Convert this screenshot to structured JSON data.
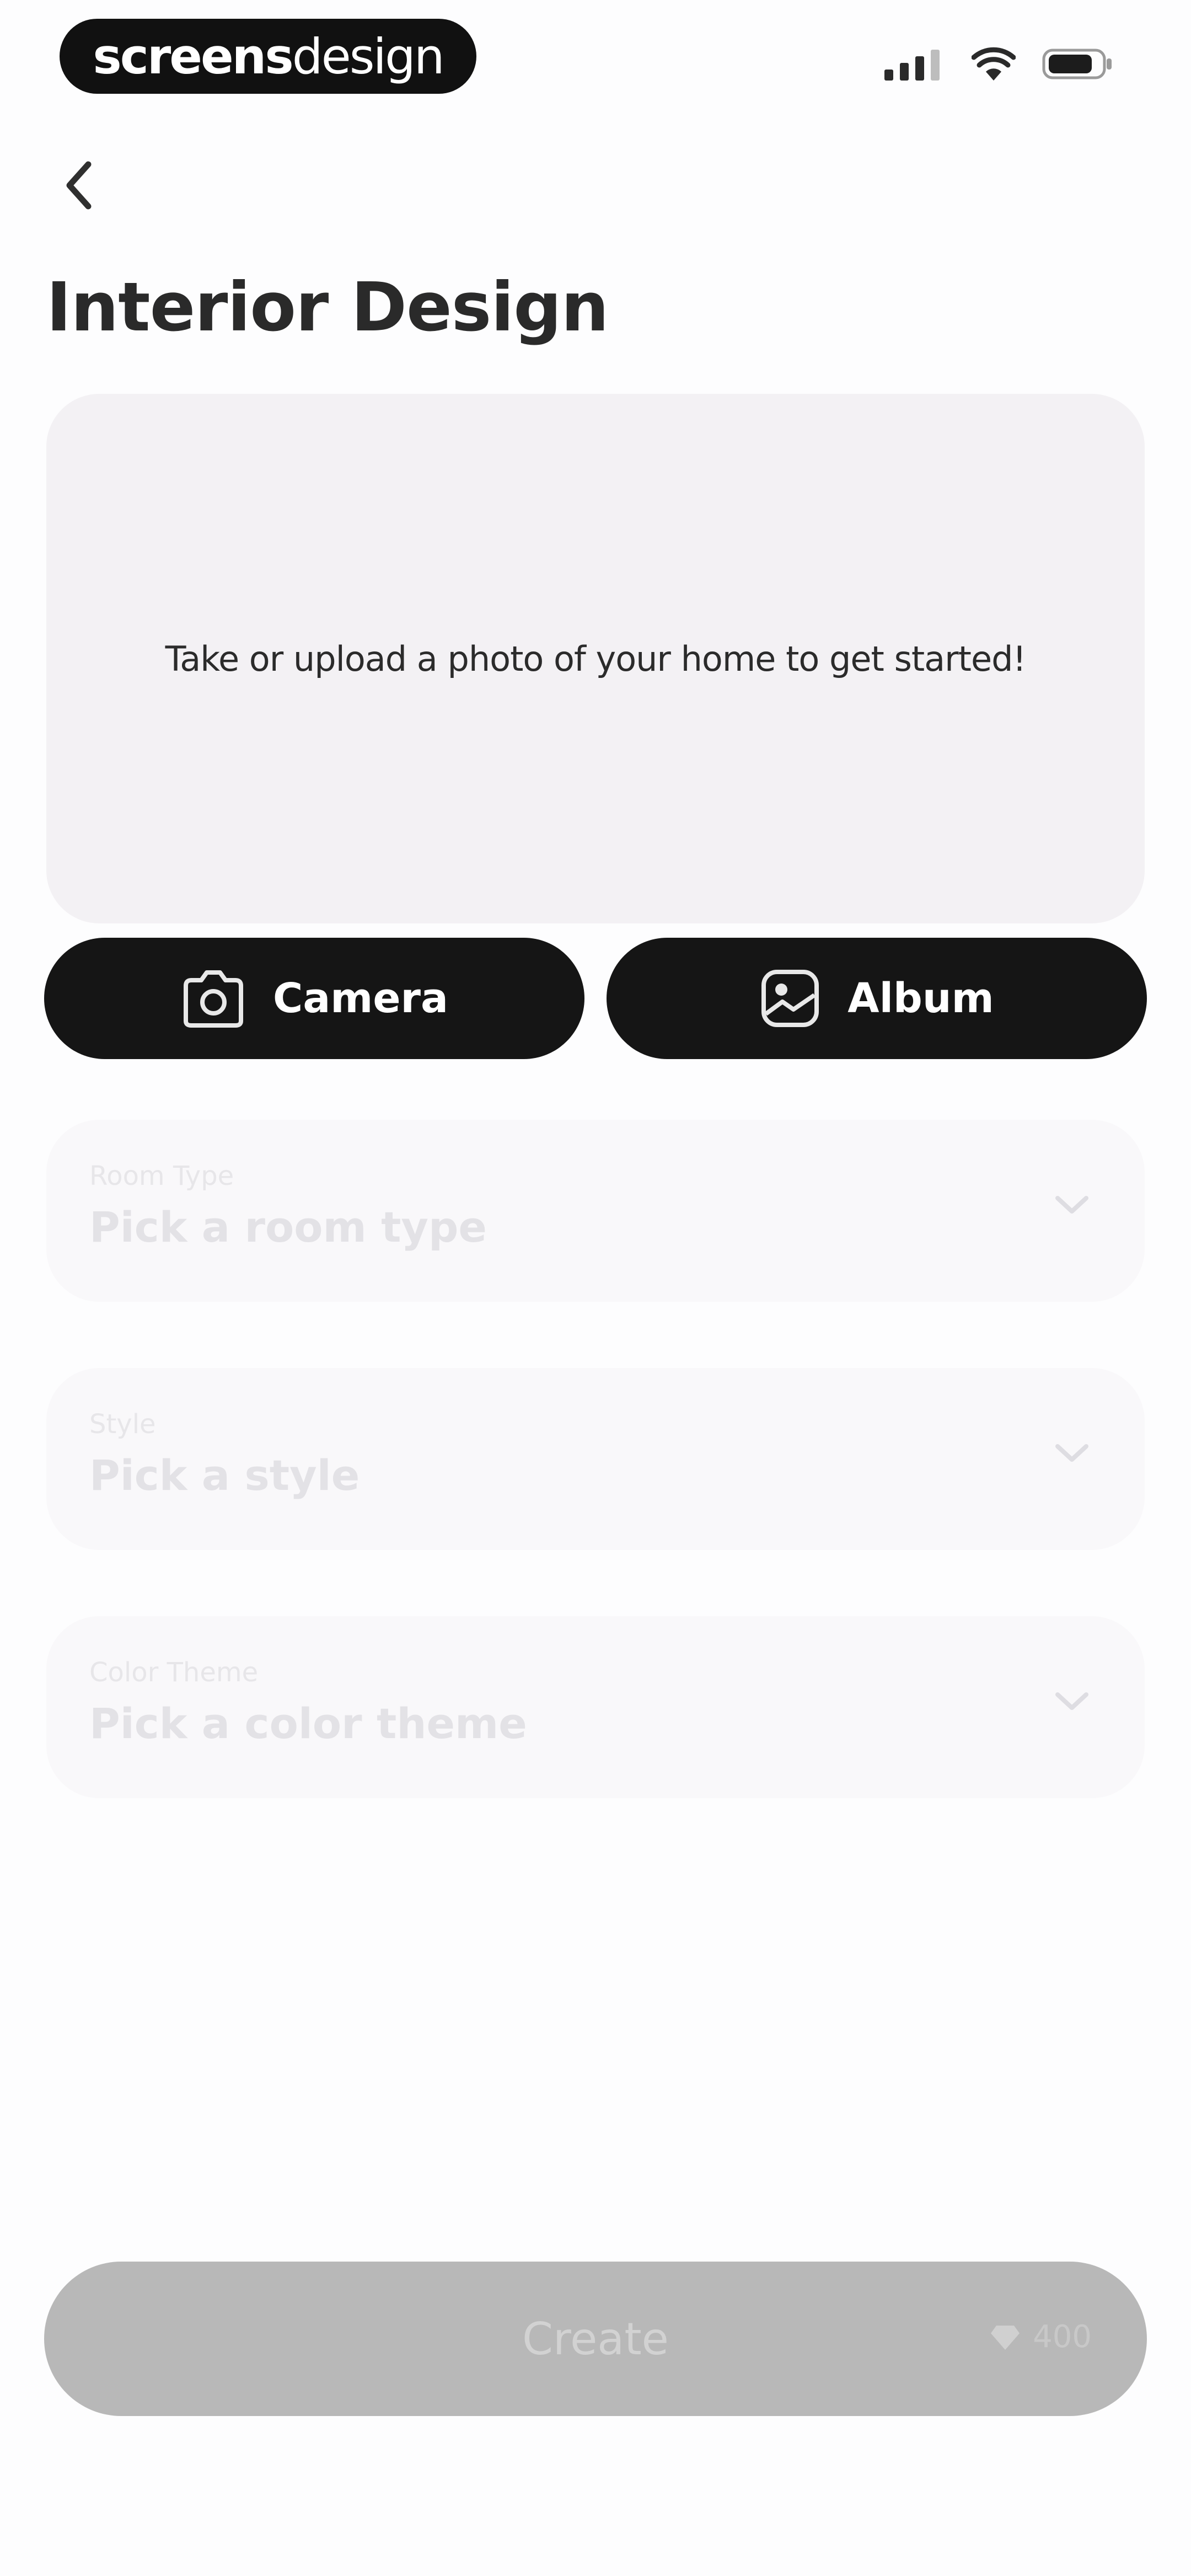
{
  "status_bar": {
    "brand_bold": "screens",
    "brand_light": "design",
    "icons": [
      "signal-icon",
      "wifi-icon",
      "battery-icon"
    ]
  },
  "header": {
    "back_icon": "chevron-left-icon",
    "title": "Interior Design"
  },
  "upload": {
    "prompt": "Take or upload a photo of your home to get started!"
  },
  "actions": {
    "camera_label": "Camera",
    "album_label": "Album"
  },
  "fields": [
    {
      "label": "Room Type",
      "placeholder": "Pick a room type"
    },
    {
      "label": "Style",
      "placeholder": "Pick a style"
    },
    {
      "label": "Color Theme",
      "placeholder": "Pick a color theme"
    }
  ],
  "create": {
    "label": "Create",
    "credits": "400",
    "credits_icon": "gem-icon"
  },
  "colors": {
    "primary_button": "#151515",
    "disabled_button": "#b8b8b8",
    "upload_bg": "#f3f1f4",
    "field_bg": "#f9f8fa"
  }
}
